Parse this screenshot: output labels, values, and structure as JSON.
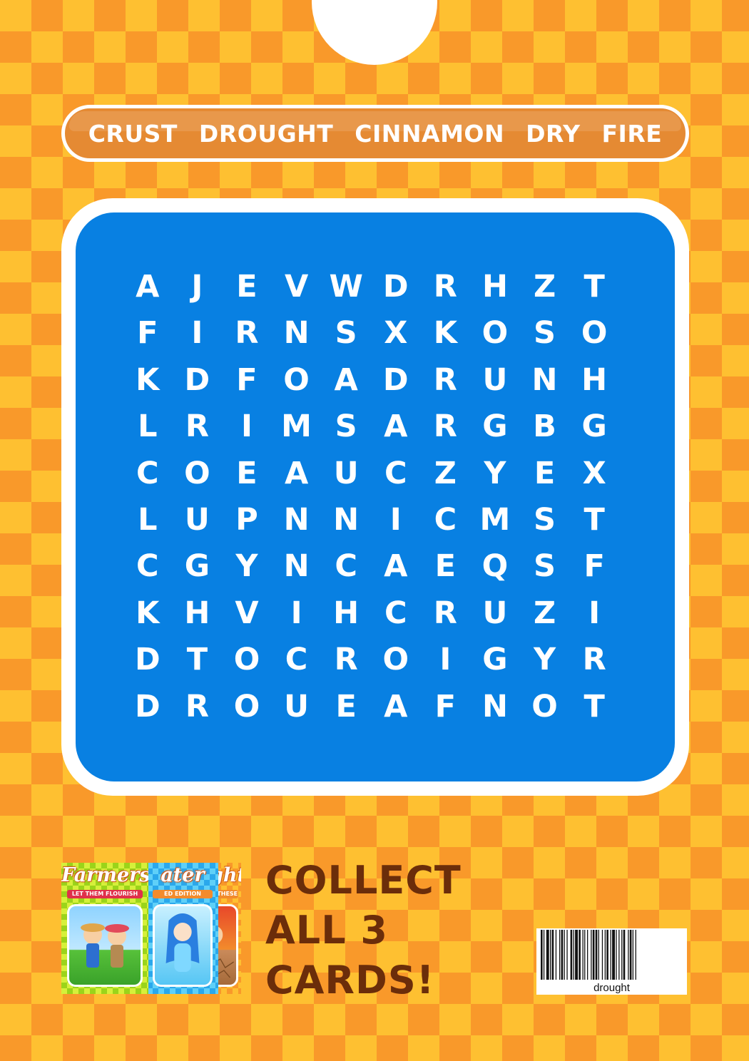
{
  "word_list": [
    "CRUST",
    "DROUGHT",
    "CINNAMON",
    "DRY",
    "FIRE"
  ],
  "grid_rows": [
    [
      "A",
      "J",
      "E",
      "V",
      "W",
      "D",
      "R",
      "H",
      "Z",
      "T"
    ],
    [
      "F",
      "I",
      "R",
      "N",
      "S",
      "X",
      "K",
      "O",
      "S",
      "O"
    ],
    [
      "K",
      "D",
      "F",
      "O",
      "A",
      "D",
      "R",
      "U",
      "N",
      "H"
    ],
    [
      "L",
      "R",
      "I",
      "M",
      "S",
      "A",
      "R",
      "G",
      "B",
      "G"
    ],
    [
      "C",
      "O",
      "E",
      "A",
      "U",
      "C",
      "Z",
      "Y",
      "E",
      "X"
    ],
    [
      "L",
      "U",
      "P",
      "N",
      "N",
      "I",
      "C",
      "M",
      "S",
      "T"
    ],
    [
      "C",
      "G",
      "Y",
      "N",
      "C",
      "A",
      "E",
      "Q",
      "S",
      "F"
    ],
    [
      "K",
      "H",
      "V",
      "I",
      "H",
      "C",
      "R",
      "U",
      "Z",
      "I"
    ],
    [
      "D",
      "T",
      "O",
      "C",
      "R",
      "O",
      "I",
      "G",
      "Y",
      "R"
    ],
    [
      "D",
      "R",
      "O",
      "U",
      "E",
      "A",
      "F",
      "N",
      "O",
      "T"
    ]
  ],
  "cards": [
    {
      "id": "farmers",
      "title": "Farmers",
      "ribbon": "LET THEM FLOURISH"
    },
    {
      "id": "water",
      "title": "ater",
      "ribbon": "ED EDITION"
    },
    {
      "id": "drought",
      "title": "ght",
      "ribbon": "D THESE"
    }
  ],
  "collect_lines": [
    "COLLECT",
    "ALL 3",
    "CARDS!"
  ],
  "barcode_caption": "drought",
  "colors": {
    "background_light": "#fec031",
    "background_dark": "#f9992a",
    "word_bar": "#e58a33",
    "grid_panel": "#0880e2",
    "collect_text": "#6b2d0a"
  }
}
